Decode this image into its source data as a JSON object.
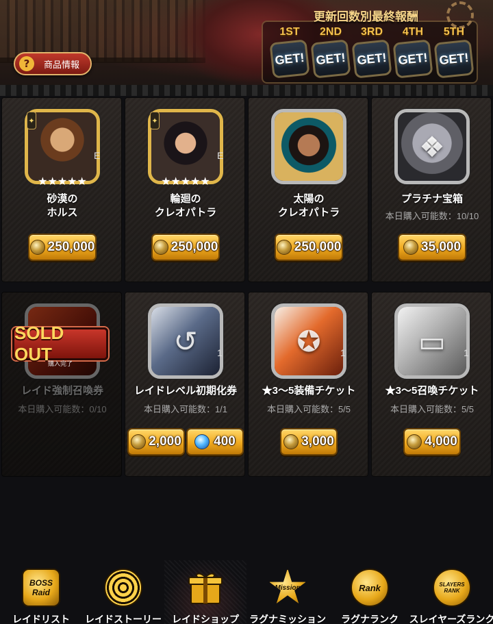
{
  "header": {
    "info_button_label": "商品情報",
    "rewards_title": "更新回数別最終報酬",
    "rewards": [
      {
        "rank": "1ST",
        "label": "GET!"
      },
      {
        "rank": "2ND",
        "label": "GET!"
      },
      {
        "rank": "3RD",
        "label": "GET!"
      },
      {
        "rank": "4TH",
        "label": "GET!"
      },
      {
        "rank": "5TH",
        "label": "GET!"
      }
    ]
  },
  "items": [
    {
      "name_line1": "砂漠の",
      "name_line2": "ホルス",
      "price": "250,000",
      "stars": "★★★★★",
      "badge": "E"
    },
    {
      "name_line1": "輪廻の",
      "name_line2": "クレオパトラ",
      "price": "250,000",
      "stars": "★★★★★",
      "badge": "E"
    },
    {
      "name_line1": "太陽の",
      "name_line2": "クレオパトラ",
      "price": "250,000"
    },
    {
      "name": "プラチナ宝箱",
      "limit": "本日購入可能数：10/10",
      "price": "35,000"
    },
    {
      "name": "レイド強制召喚券",
      "limit": "本日購入可能数：0/10",
      "count": "1",
      "sold_out": "SOLD OUT",
      "sold_out_sub": "購入完了"
    },
    {
      "name": "レイドレベル初期化券",
      "limit": "本日購入可能数：1/1",
      "count": "1",
      "price": "2,000",
      "price2": "400"
    },
    {
      "name": "★3〜5装備チケット",
      "limit": "本日購入可能数：5/5",
      "count": "1",
      "price": "3,000"
    },
    {
      "name": "★3〜5召喚チケット",
      "limit": "本日購入可能数：5/5",
      "count": "1",
      "price": "4,000"
    }
  ],
  "nav": [
    {
      "label": "レイドリスト",
      "emblem": "BOSS Raid"
    },
    {
      "label": "レイドストーリー",
      "emblem": ""
    },
    {
      "label": "レイドショップ",
      "emblem": ""
    },
    {
      "label": "ラグナミッション",
      "emblem": "Mission"
    },
    {
      "label": "ラグナランク",
      "emblem": "Rank"
    },
    {
      "label": "スレイヤーズランク",
      "emblem": "SLAYERS RANK"
    }
  ],
  "colors": {
    "accent_gold": "#f0a91e",
    "sold_out_red": "#c8362a",
    "background": "#0f0f12"
  }
}
